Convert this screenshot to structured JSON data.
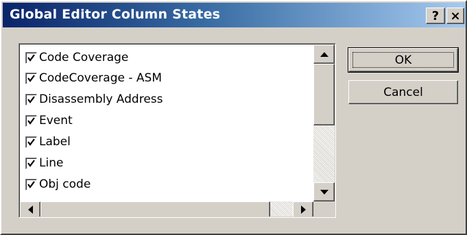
{
  "window": {
    "title": "Global Editor Column States",
    "help_glyph": "?",
    "close_glyph": "×"
  },
  "columns": [
    {
      "label": "Code Coverage",
      "checked": true
    },
    {
      "label": "CodeCoverage - ASM",
      "checked": true
    },
    {
      "label": "Disassembly Address",
      "checked": true
    },
    {
      "label": "Event",
      "checked": true
    },
    {
      "label": "Label",
      "checked": true
    },
    {
      "label": "Line",
      "checked": true
    },
    {
      "label": "Obj code",
      "checked": true
    }
  ],
  "buttons": {
    "ok": "OK",
    "cancel": "Cancel"
  },
  "icons": {
    "check": "checkmark-icon",
    "up": "arrow-up-icon",
    "down": "arrow-down-icon",
    "left": "arrow-left-icon",
    "right": "arrow-right-icon"
  },
  "colors": {
    "title_start": "#0a246a",
    "title_end": "#a6caf0",
    "face": "#d4d0c8"
  }
}
